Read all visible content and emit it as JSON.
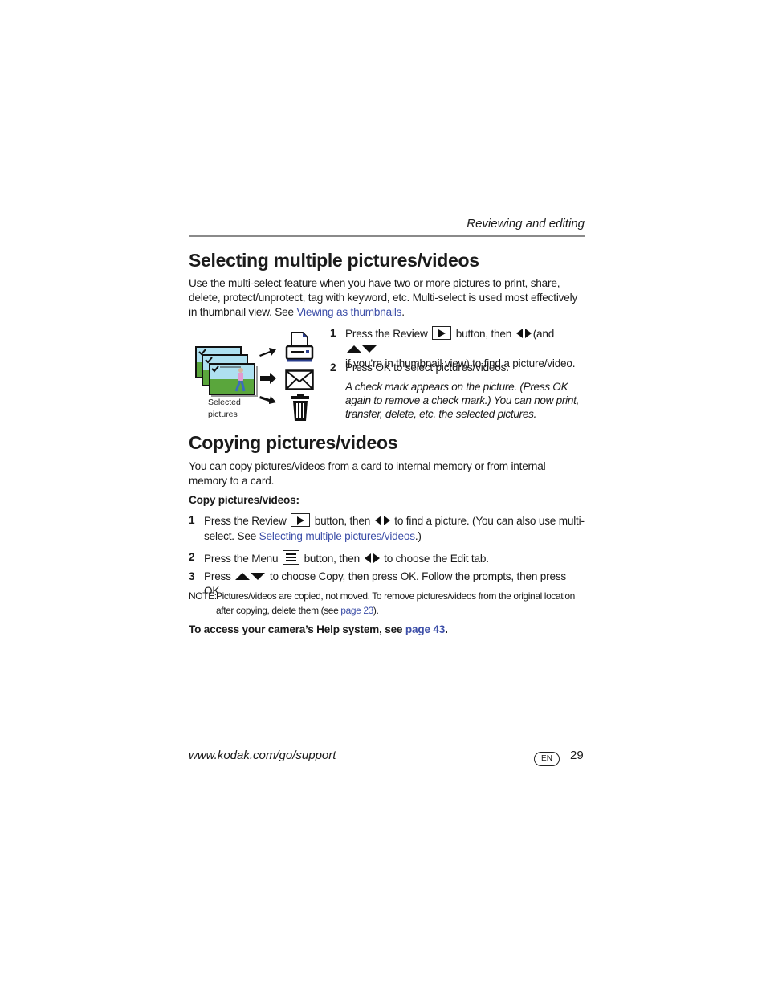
{
  "header": {
    "section": "Reviewing and editing"
  },
  "section1": {
    "title": "Selecting multiple pictures/videos",
    "intro": "Use the multi-select feature when you have two or more pictures to print, share, delete, protect/unprotect, tag with keyword, etc. Multi-select is used most effectively in thumbnail view. See ",
    "intro_link": "Viewing as thumbnails",
    "intro_end": ".",
    "illustration_caption_line1": "Selected",
    "illustration_caption_line2": "pictures",
    "steps": [
      {
        "num": "1",
        "a": "Press the Review",
        "b": "button, then",
        "c": "(and",
        "d": "if you’re in thumbnail view) to find a picture/video."
      },
      {
        "num": "2",
        "a": "Press OK to select pictures/videos."
      }
    ],
    "note": "A check mark appears on the picture. (Press OK again to remove a check mark.) You can now print, transfer, delete, etc. the selected pictures."
  },
  "section2": {
    "title": "Copying pictures/videos",
    "intro": "You can copy pictures/videos from a card to internal memory or from internal memory to a card.",
    "subhead": "Copy pictures/videos:",
    "steps": [
      {
        "num": "1",
        "a": "Press the Review",
        "b": "button, then",
        "c": "to find a picture. (You can also use multi-select. See ",
        "link": "Selecting multiple pictures/videos",
        "d": ".)"
      },
      {
        "num": "2",
        "a": "Press the Menu",
        "b": "button, then",
        "c": "to choose the Edit tab."
      },
      {
        "num": "3",
        "a": "Press",
        "b": "to choose Copy, then press OK. Follow the prompts, then press OK."
      }
    ],
    "note_label": "NOTE:",
    "note_text": "Pictures/videos are copied, not moved. To remove pictures/videos from the original location after copying, delete them (see ",
    "note_link": "page 23",
    "note_end": ").",
    "help_text": "To access your camera’s Help system, see ",
    "help_link": "page 43",
    "help_end": "."
  },
  "footer": {
    "url": "www.kodak.com/go/support",
    "lang_badge": "EN",
    "page_number": "29"
  },
  "colors": {
    "link": "#3d4fa8",
    "rule": "#8a8a8a"
  }
}
